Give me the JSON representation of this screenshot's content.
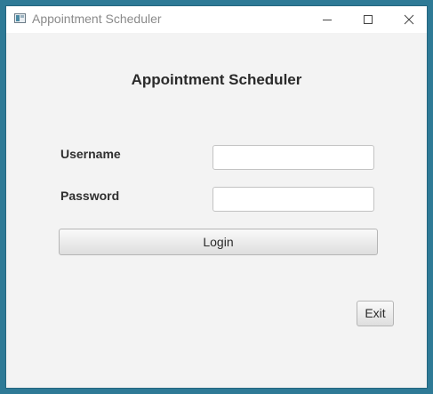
{
  "window": {
    "title": "Appointment Scheduler",
    "icon": "app-window-icon",
    "controls": [
      "minimize-icon",
      "maximize-icon",
      "close-icon"
    ]
  },
  "form": {
    "heading": "Appointment Scheduler",
    "username_label": "Username",
    "username_value": "",
    "password_label": "Password",
    "password_value": "",
    "login_label": "Login",
    "exit_label": "Exit"
  },
  "colors": {
    "desktop": "#2e7a96",
    "window_bg": "#f3f3f3",
    "titlebar_bg": "#ffffff"
  }
}
